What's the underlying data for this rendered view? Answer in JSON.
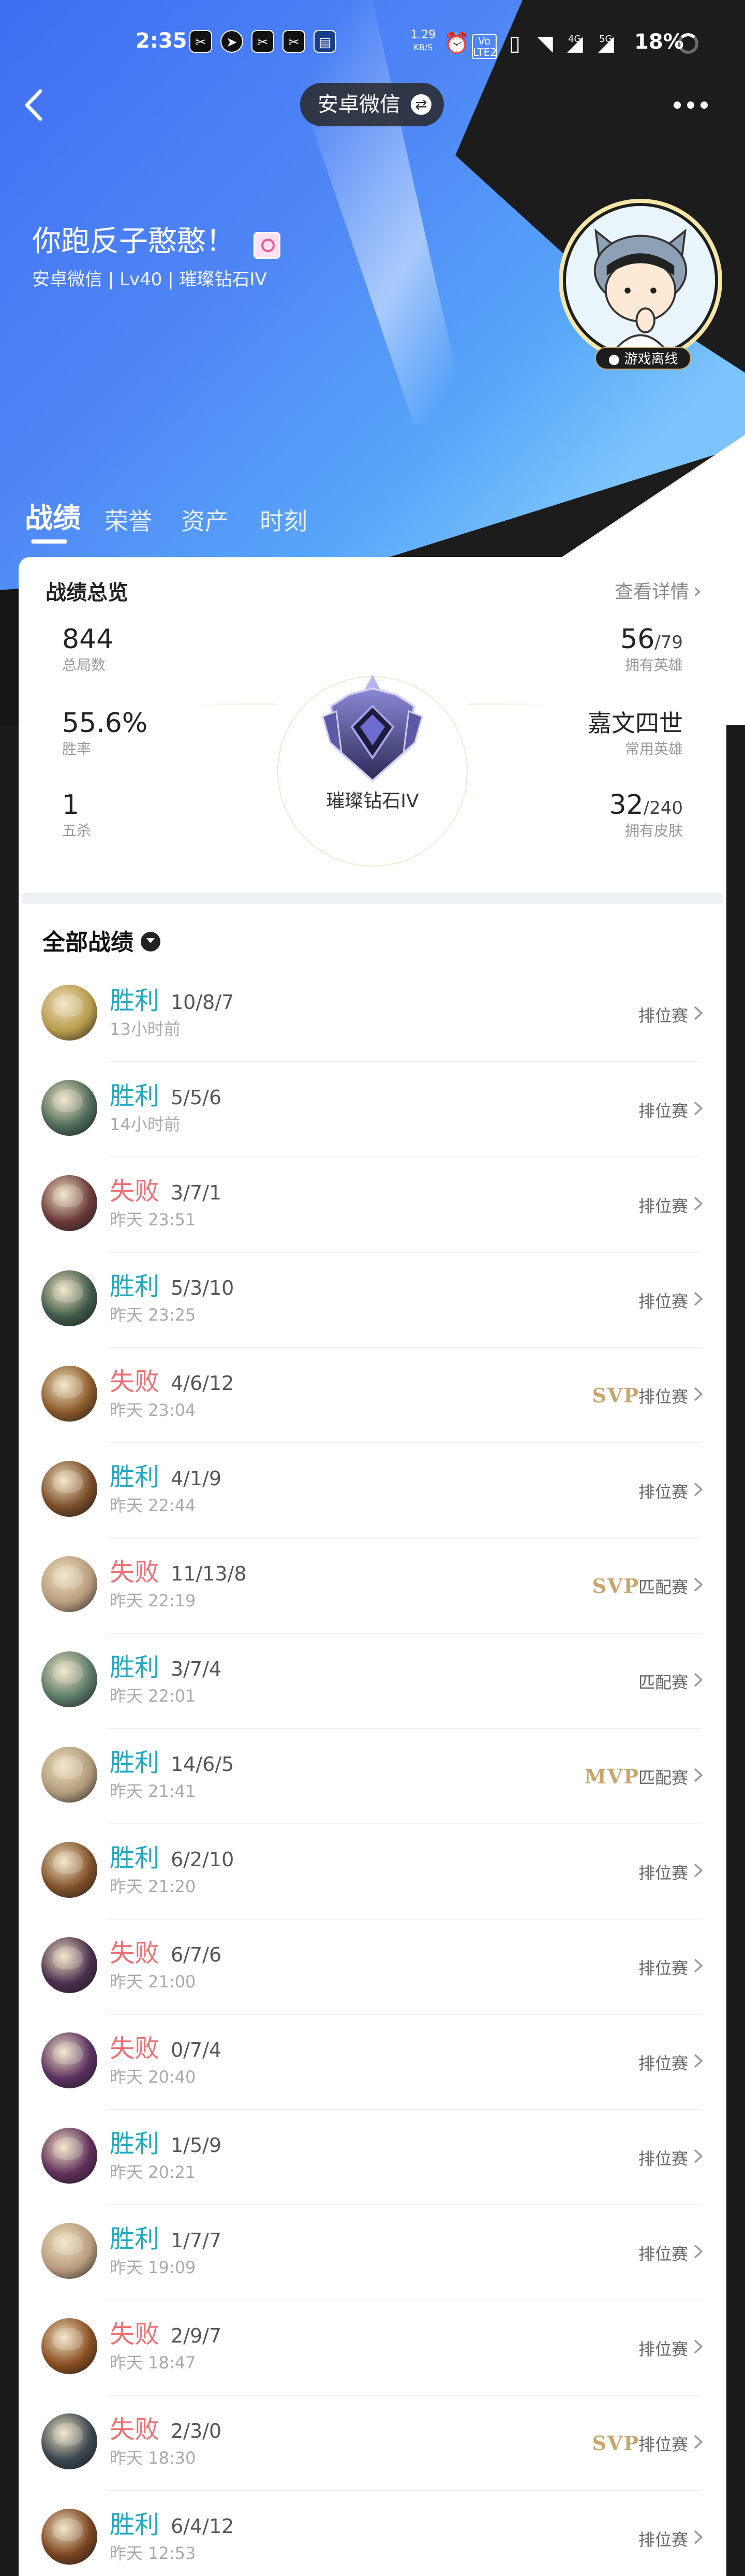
{
  "status_bar": {
    "time": "2:35",
    "app_icons": [
      "capcut-icon",
      "telegram-icon",
      "capcut-icon",
      "capcut-icon",
      "app-icon"
    ],
    "net_speed": "1.29",
    "net_speed_unit": "KB/S",
    "volte_label": "Vo LTE2",
    "signal_4g_label": "4G",
    "signal_5g_label": "5G",
    "battery": "18%"
  },
  "nav": {
    "source_label": "安卓微信",
    "swap_glyph": "⇄"
  },
  "profile": {
    "name": "你跑反子憨憨！",
    "subtitle": "安卓微信 | Lv40 | 璀璨钻石IV",
    "status": "● 游戏离线"
  },
  "tabs": [
    {
      "label": "战绩",
      "active": true
    },
    {
      "label": "荣誉",
      "active": false
    },
    {
      "label": "资产",
      "active": false
    },
    {
      "label": "时刻",
      "active": false
    }
  ],
  "overview": {
    "title": "战绩总览",
    "more_label": "查看详情",
    "total_games": "844",
    "total_games_label": "总局数",
    "win_rate": "55.6%",
    "win_rate_label": "胜率",
    "pentakills": "1",
    "pentakills_label": "五杀",
    "heroes_owned": "56",
    "heroes_total": "/79",
    "heroes_label": "拥有英雄",
    "common_hero": "嘉文四世",
    "common_hero_label": "常用英雄",
    "skins_owned": "32",
    "skins_total": "/240",
    "skins_label": "拥有皮肤",
    "rank_name": "璀璨钻石IV"
  },
  "records": {
    "title": "全部战绩",
    "matches": [
      {
        "result": "胜利",
        "win": true,
        "kda": "10/8/7",
        "time": "13小时前",
        "mode": "排位赛",
        "badge": "",
        "avatar_color": "#b79a4c"
      },
      {
        "result": "胜利",
        "win": true,
        "kda": "5/5/6",
        "time": "14小时前",
        "mode": "排位赛",
        "badge": "",
        "avatar_color": "#4d6a5a"
      },
      {
        "result": "失败",
        "win": false,
        "kda": "3/7/1",
        "time": "昨天 23:51",
        "mode": "排位赛",
        "badge": "",
        "avatar_color": "#6b3a3a"
      },
      {
        "result": "胜利",
        "win": true,
        "kda": "5/3/10",
        "time": "昨天 23:25",
        "mode": "排位赛",
        "badge": "",
        "avatar_color": "#3f5a4a"
      },
      {
        "result": "失败",
        "win": false,
        "kda": "4/6/12",
        "time": "昨天 23:04",
        "mode": "排位赛",
        "badge": "SVP",
        "avatar_color": "#8a5a2a"
      },
      {
        "result": "胜利",
        "win": true,
        "kda": "4/1/9",
        "time": "昨天 22:44",
        "mode": "排位赛",
        "badge": "",
        "avatar_color": "#7a4c28"
      },
      {
        "result": "失败",
        "win": false,
        "kda": "11/13/8",
        "time": "昨天 22:19",
        "mode": "匹配赛",
        "badge": "SVP",
        "avatar_color": "#b89c7e"
      },
      {
        "result": "胜利",
        "win": true,
        "kda": "3/7/4",
        "time": "昨天 22:01",
        "mode": "匹配赛",
        "badge": "",
        "avatar_color": "#5a7a68"
      },
      {
        "result": "胜利",
        "win": true,
        "kda": "14/6/5",
        "time": "昨天 21:41",
        "mode": "匹配赛",
        "badge": "MVP",
        "avatar_color": "#b09a7a"
      },
      {
        "result": "胜利",
        "win": true,
        "kda": "6/2/10",
        "time": "昨天 21:20",
        "mode": "排位赛",
        "badge": "",
        "avatar_color": "#80502a"
      },
      {
        "result": "失败",
        "win": false,
        "kda": "6/7/6",
        "time": "昨天 21:00",
        "mode": "排位赛",
        "badge": "",
        "avatar_color": "#4a2e4e"
      },
      {
        "result": "失败",
        "win": false,
        "kda": "0/7/4",
        "time": "昨天 20:40",
        "mode": "排位赛",
        "badge": "",
        "avatar_color": "#5a3060"
      },
      {
        "result": "胜利",
        "win": true,
        "kda": "1/5/9",
        "time": "昨天 20:21",
        "mode": "排位赛",
        "badge": "",
        "avatar_color": "#5e2e5a"
      },
      {
        "result": "胜利",
        "win": true,
        "kda": "1/7/7",
        "time": "昨天 19:09",
        "mode": "排位赛",
        "badge": "",
        "avatar_color": "#b89c7e"
      },
      {
        "result": "失败",
        "win": false,
        "kda": "2/9/7",
        "time": "昨天 18:47",
        "mode": "排位赛",
        "badge": "",
        "avatar_color": "#8a4e22"
      },
      {
        "result": "失败",
        "win": false,
        "kda": "2/3/0",
        "time": "昨天 18:30",
        "mode": "排位赛",
        "badge": "SVP",
        "avatar_color": "#3a4650"
      },
      {
        "result": "胜利",
        "win": true,
        "kda": "6/4/12",
        "time": "昨天 12:53",
        "mode": "排位赛",
        "badge": "",
        "avatar_color": "#7a4420"
      }
    ]
  },
  "colors": {
    "win": "#20a8c2",
    "loss": "#ef6e72",
    "badge_gold": "#c9a56b",
    "hero_blue": "#4f86f6"
  }
}
